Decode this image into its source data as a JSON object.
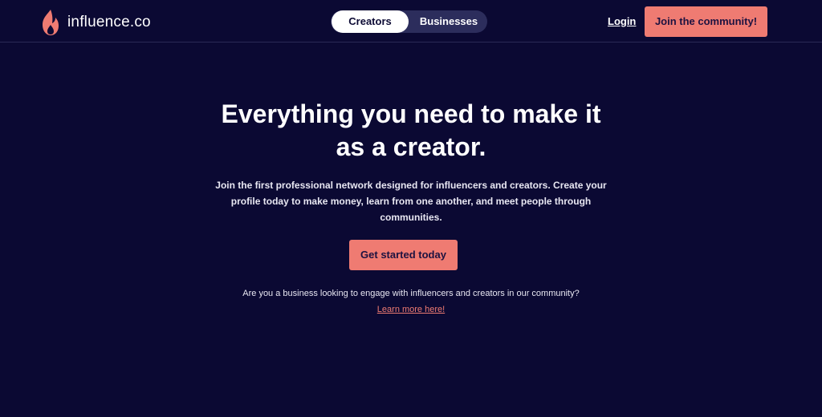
{
  "brand": {
    "name": "influence.co",
    "icon": "flame-icon",
    "accent_color": "#ef7b72",
    "background_color": "#0b0933"
  },
  "nav": {
    "toggle": {
      "options": [
        "Creators",
        "Businesses"
      ],
      "selected": "Creators"
    },
    "login_label": "Login",
    "join_label": "Join the community!"
  },
  "hero": {
    "title": "Everything you need to make it as a creator.",
    "subtitle": "Join the first professional network designed for influencers and creators. Create your profile today to make money, learn from one another, and meet people through communities.",
    "cta_label": "Get started today",
    "business_question": "Are you a business looking to engage with influencers and creators in our community?",
    "business_link": "Learn more here!"
  }
}
